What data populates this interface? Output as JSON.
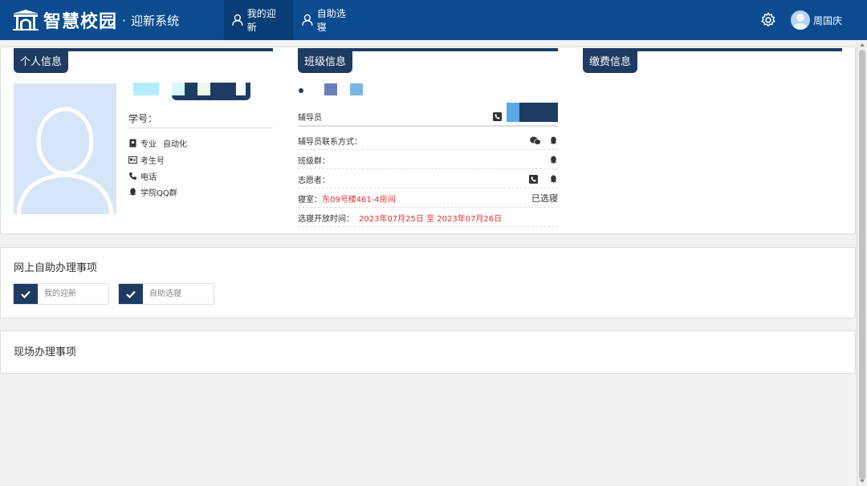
{
  "header": {
    "app_name": "智慧校园",
    "separator": "·",
    "system_name": "迎新系统",
    "nav": [
      {
        "label": "我的迎新",
        "active": true
      },
      {
        "label": "自助选寝",
        "active": false
      }
    ],
    "user_name": "周国庆"
  },
  "personal": {
    "tab": "个人信息",
    "student_no_label": "学号：",
    "major_label": "专业",
    "major_value": "自动化",
    "exam_no_label": "考生号",
    "phone_label": "电话",
    "qq_label": "学院QQ群"
  },
  "class_info": {
    "tab": "班级信息",
    "counselor_label": "辅导员",
    "counselor_contact_label": "辅导员联系方式：",
    "class_group_label": "班级群：",
    "volunteer_label": "志愿者：",
    "dorm_label": "寝室：",
    "dorm_value": "东09号楼461-4房间",
    "dorm_status": "已选寝",
    "select_time_label": "选寝开放时间：",
    "select_time_value": "2023年07月25日 至 2023年07月26日"
  },
  "payment": {
    "tab": "缴费信息"
  },
  "online_tasks": {
    "title": "网上自助办理事项",
    "items": [
      {
        "label": "我的迎新"
      },
      {
        "label": "自助选寝"
      }
    ]
  },
  "onsite_tasks": {
    "title": "现场办理事项"
  },
  "colors": {
    "header_bg": "#0b4b90",
    "accent_dark": "#1e3c62",
    "highlight_red": "#e03030"
  }
}
